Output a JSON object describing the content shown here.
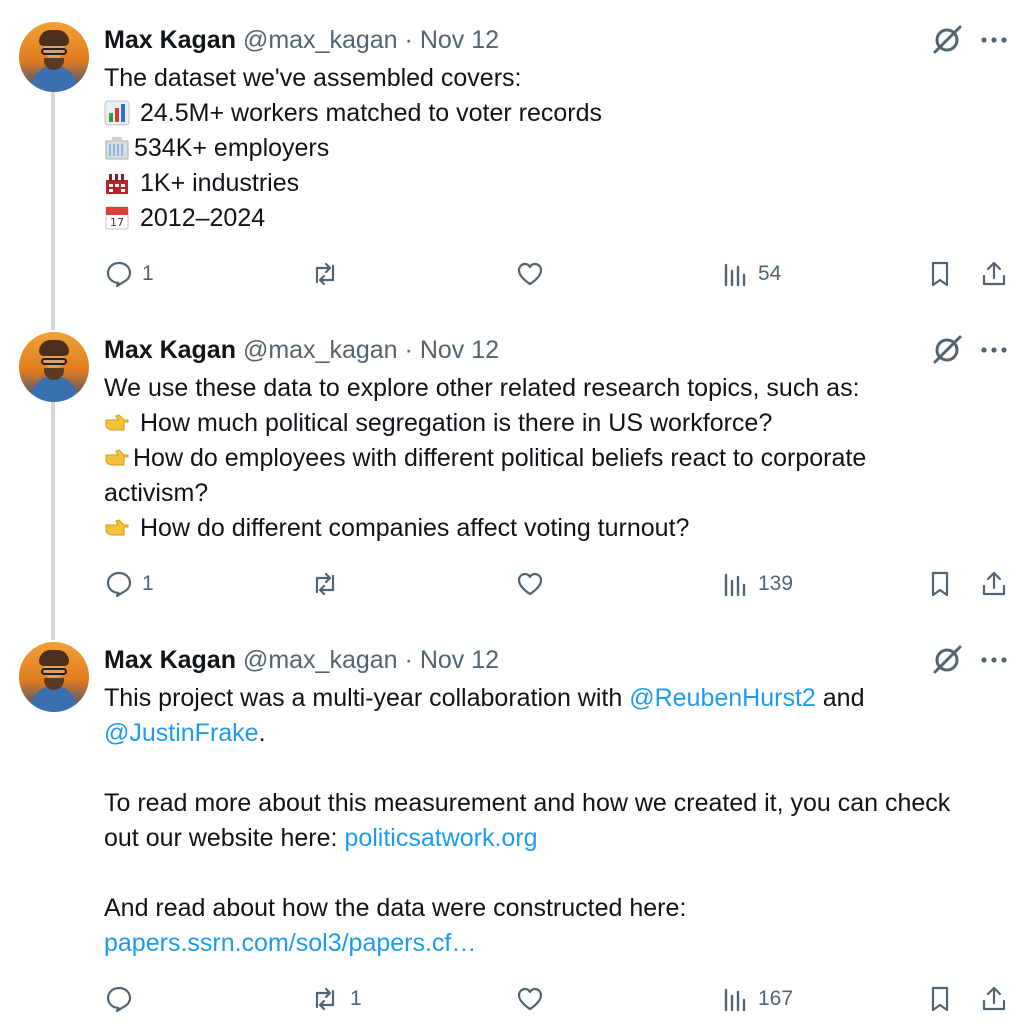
{
  "tweets": [
    {
      "author": {
        "name": "Max Kagan",
        "handle": "@max_kagan",
        "date_sep": "·",
        "date": "Nov 12"
      },
      "lines": [
        {
          "text": "The dataset we've assembled covers:"
        },
        {
          "emoji": "bar-chart-emoji",
          "text": "24.5M+ workers matched to voter records"
        },
        {
          "emoji": "office-building-emoji",
          "text": "534K+ employers"
        },
        {
          "emoji": "factory-emoji",
          "text": "1K+ industries"
        },
        {
          "emoji": "calendar-emoji",
          "text": "2012–2024"
        }
      ],
      "actions": {
        "replies": "1",
        "reposts": "",
        "likes": "",
        "views": "54"
      }
    },
    {
      "author": {
        "name": "Max Kagan",
        "handle": "@max_kagan",
        "date_sep": "·",
        "date": "Nov 12"
      },
      "lines": [
        {
          "text": "We use these data to explore other related research topics, such as:"
        },
        {
          "emoji": "pointing-right-emoji",
          "text": "How much political segregation is there in US workforce?"
        },
        {
          "emoji": "pointing-right-emoji",
          "text": "How do employees with different political beliefs react to corporate"
        },
        {
          "text": "activism?"
        },
        {
          "emoji": "pointing-right-emoji",
          "text": "How do different companies affect voting turnout?"
        }
      ],
      "actions": {
        "replies": "1",
        "reposts": "",
        "likes": "",
        "views": "139"
      }
    },
    {
      "author": {
        "name": "Max Kagan",
        "handle": "@max_kagan",
        "date_sep": "·",
        "date": "Nov 12"
      },
      "p1_prefix": "This project was a multi-year collaboration with ",
      "mention1": "@ReubenHurst2",
      "p1_mid": " and",
      "mention2": "@JustinFrake",
      "p1_end": ".",
      "p2_line1": "To read more about this measurement and how we created it, you can check",
      "p2_prefix": "out our website here: ",
      "link1": "politicsatwork.org",
      "p3_line1": "And read about how the data were constructed here:",
      "link2": "papers.ssrn.com/sol3/papers.cf…",
      "actions": {
        "replies": "",
        "reposts": "1",
        "likes": "",
        "views": "167"
      }
    }
  ],
  "colors": {
    "text": "#0f1419",
    "secondary": "#536471",
    "link": "#1d9bf0",
    "thread_line": "#cfd9de"
  }
}
